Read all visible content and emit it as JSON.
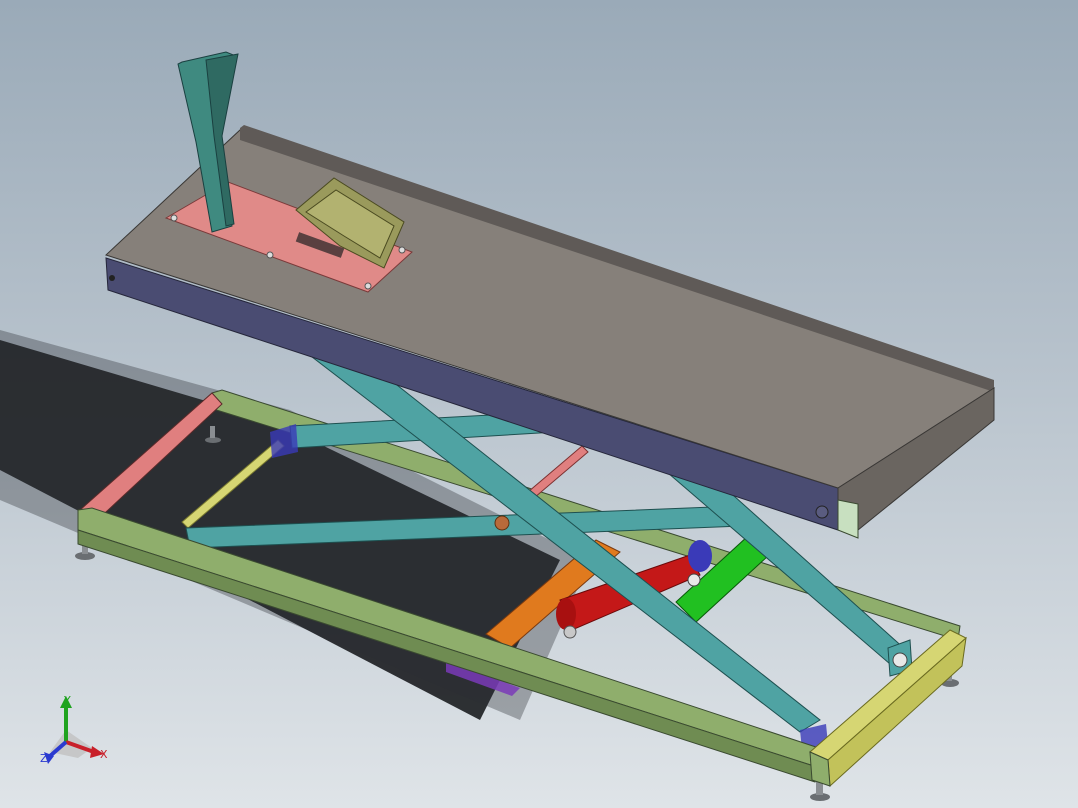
{
  "view": {
    "background_top": "#9aaab8",
    "background_bottom": "#dfe4e8",
    "shadow_color": "#1e2124"
  },
  "model": {
    "description_icon": "scissor-lift-table-icon",
    "colors": {
      "platform_top": "#86807a",
      "platform_side": "#4a4c72",
      "platform_end": "#5f5a57",
      "wheel_plate": "#e08a88",
      "wheel_chock": "#3f8a80",
      "front_cradle": "#9a9a5c",
      "scissor_arm": "#4fa3a3",
      "base_frame": "#8fae6c",
      "base_end_left": "#e07f7f",
      "base_end_right": "#d6d673",
      "cross_rod": "#d6d673",
      "hydraulic_cylinder": "#c41818",
      "lift_bracket": "#21c021",
      "orange_beam": "#e07a1e",
      "purple_parts": "#7a3ab8",
      "feet": "#6a6e72"
    }
  },
  "triad": {
    "x_label": "X",
    "y_label": "Y",
    "z_label": "Z",
    "x_color": "#c8202a",
    "y_color": "#1fa31f",
    "z_color": "#2a3ad0"
  }
}
